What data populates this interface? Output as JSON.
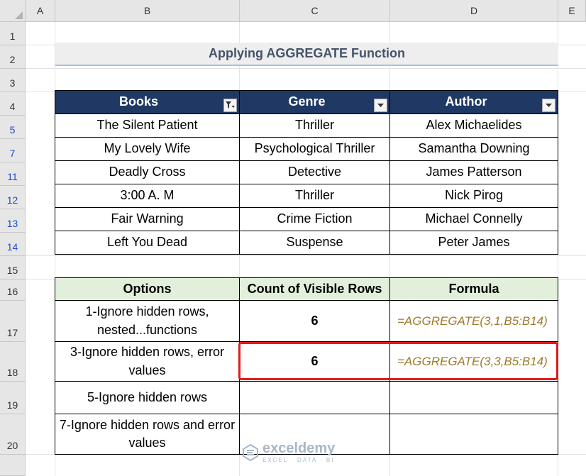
{
  "columns": [
    "A",
    "B",
    "C",
    "D",
    "E"
  ],
  "rows": [
    "1",
    "2",
    "3",
    "4",
    "5",
    "7",
    "11",
    "12",
    "13",
    "14",
    "15",
    "16",
    "17",
    "18",
    "19",
    "20"
  ],
  "title": "Applying AGGREGATE Function",
  "books_table": {
    "headers": [
      "Books",
      "Genre",
      "Author"
    ],
    "rows": [
      [
        "The Silent Patient",
        "Thriller",
        "Alex Michaelides"
      ],
      [
        "My Lovely Wife",
        "Psychological Thriller",
        "Samantha Downing"
      ],
      [
        "Deadly Cross",
        "Detective",
        "James Patterson"
      ],
      [
        "3:00 A. M",
        "Thriller",
        "Nick Pirog"
      ],
      [
        "Fair Warning",
        "Crime Fiction",
        "Michael Connelly"
      ],
      [
        "Left You Dead",
        "Suspense",
        "Peter James"
      ]
    ]
  },
  "options_table": {
    "headers": [
      "Options",
      "Count of Visible Rows",
      "Formula"
    ],
    "rows": [
      [
        "1-Ignore hidden rows, nested...functions",
        "6",
        "=AGGREGATE(3,1,B5:B14)"
      ],
      [
        "3-Ignore hidden rows, error values",
        "6",
        "=AGGREGATE(3,3,B5:B14)"
      ],
      [
        "5-Ignore hidden rows",
        "",
        ""
      ],
      [
        "7-Ignore hidden rows and error values",
        "",
        ""
      ]
    ]
  },
  "watermark": {
    "name": "exceldemy",
    "tagline": "EXCEL · DATA · BI"
  },
  "colors": {
    "header_blue": "#203864",
    "header_green": "#e2efda",
    "highlight_red": "#e0191e",
    "formula_text": "#9c7a2a"
  },
  "icons": [
    "filter-active-icon",
    "dropdown-arrow-icon",
    "exceldemy-logo-icon"
  ]
}
